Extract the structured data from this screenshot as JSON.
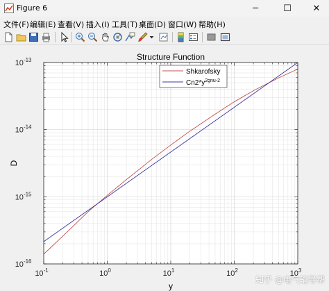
{
  "window": {
    "title": "Figure 6",
    "controls": {
      "minimize": "─",
      "maximize": "☐",
      "close": "✕"
    }
  },
  "menu": [
    "文件(F)",
    "编辑(E)",
    "查看(V)",
    "插入(I)",
    "工具(T)",
    "桌面(D)",
    "窗口(W)",
    "帮助(H)"
  ],
  "toolbar": {
    "icons": [
      "new-figure-icon",
      "open-file-icon",
      "save-icon",
      "print-icon",
      "select-arrow-icon",
      "zoom-in-icon",
      "zoom-out-icon",
      "pan-icon",
      "rotate-3d-icon",
      "data-cursor-icon",
      "brush-icon",
      "brush-dropdown-icon",
      "link-plot-icon",
      "colorbar-icon",
      "legend-icon",
      "hide-plot-tools-icon",
      "show-plot-tools-icon"
    ]
  },
  "chart_data": {
    "type": "line",
    "title": "Structure Function",
    "xlabel": "y",
    "ylabel": "D",
    "xscale": "log",
    "yscale": "log",
    "xlim": [
      0.1,
      1000
    ],
    "ylim": [
      1e-16,
      1e-13
    ],
    "x_tick_labels": [
      {
        "value": 0.1,
        "base": "10",
        "exp": "-1"
      },
      {
        "value": 1,
        "base": "10",
        "exp": "0"
      },
      {
        "value": 10,
        "base": "10",
        "exp": "1"
      },
      {
        "value": 100,
        "base": "10",
        "exp": "2"
      },
      {
        "value": 1000,
        "base": "10",
        "exp": "3"
      }
    ],
    "y_tick_labels": [
      {
        "value": 1e-16,
        "base": "10",
        "exp": "-16"
      },
      {
        "value": 1e-15,
        "base": "10",
        "exp": "-15"
      },
      {
        "value": 1e-14,
        "base": "10",
        "exp": "-14"
      },
      {
        "value": 1e-13,
        "base": "10",
        "exp": "-13"
      }
    ],
    "grid": true,
    "legend_position": "top-right",
    "series": [
      {
        "name": "Shkarofsky",
        "color": "#c0504d",
        "x": [
          0.1,
          0.2,
          0.5,
          1,
          2,
          5,
          10,
          20,
          50,
          100,
          200,
          500,
          1000
        ],
        "y": [
          1.4e-16,
          2.6e-16,
          6e-16,
          1.05e-15,
          1.8e-15,
          3.6e-15,
          5.9e-15,
          9.5e-15,
          1.7e-14,
          2.6e-14,
          3.8e-14,
          5.9e-14,
          8e-14
        ]
      },
      {
        "name": "Cn2*y",
        "name_sup": "2gnu-2",
        "color": "#3b3b9e",
        "x": [
          0.1,
          1000
        ],
        "y": [
          2.15e-16,
          1e-13
        ]
      }
    ]
  },
  "watermark": "知乎 @电气输导帮"
}
